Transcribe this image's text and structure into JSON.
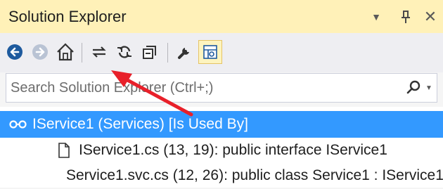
{
  "panel": {
    "title": "Solution Explorer",
    "dropdown_icon": "▼",
    "pin_icon": "pin-icon",
    "close_icon": "✕"
  },
  "toolbar": {
    "buttons": [
      {
        "name": "back",
        "icon": "back-arrow-icon"
      },
      {
        "name": "forward",
        "icon": "forward-arrow-icon"
      },
      {
        "name": "home",
        "icon": "home-icon"
      },
      {
        "name": "sync",
        "icon": "sync-with-active-document-icon"
      },
      {
        "name": "refresh",
        "icon": "refresh-icon"
      },
      {
        "name": "collapse-all",
        "icon": "collapse-all-icon"
      },
      {
        "name": "properties",
        "icon": "wrench-icon"
      },
      {
        "name": "preview",
        "icon": "preview-selected-items-icon",
        "active": true
      }
    ]
  },
  "search": {
    "placeholder": "Search Solution Explorer (Ctrl+;)",
    "icon": "search-icon"
  },
  "tree": {
    "items": [
      {
        "label": "IService1  (Services) [Is Used By]",
        "icon": "interface-icon",
        "selected": true
      },
      {
        "label": "IService1.cs (13, 19): public interface IService1",
        "icon": "file-icon"
      },
      {
        "label": "Service1.svc.cs (12, 26): public class Service1 : IService1",
        "icon": "file-icon"
      }
    ]
  },
  "annotation": {
    "color": "#e8202a",
    "icon": "red-arrow-pointing-home"
  },
  "colors": {
    "title_bg": "#fff1b8",
    "selection": "#3399ff",
    "toolbar_bg": "#eeeef2"
  }
}
